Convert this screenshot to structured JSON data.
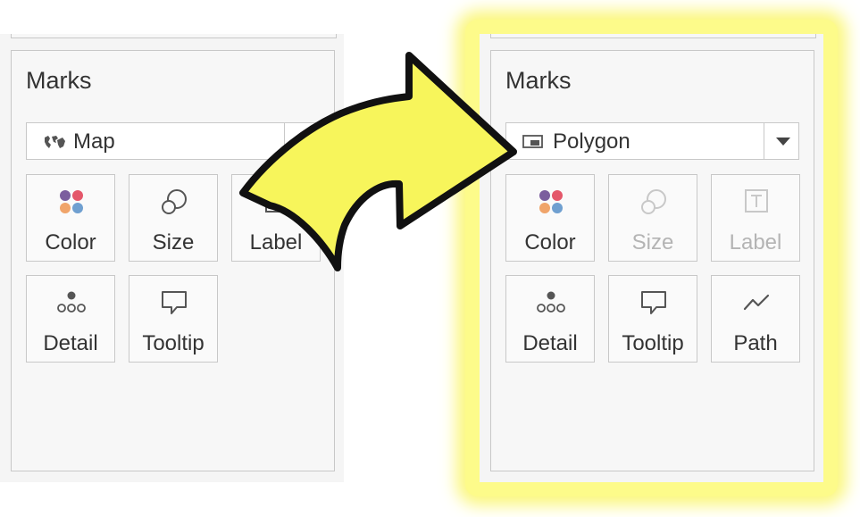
{
  "left_panel": {
    "title": "Marks",
    "mark_type": "Map",
    "buttons": {
      "color": "Color",
      "size": "Size",
      "label": "Label",
      "detail": "Detail",
      "tooltip": "Tooltip"
    }
  },
  "right_panel": {
    "title": "Marks",
    "mark_type": "Polygon",
    "buttons": {
      "color": "Color",
      "size": "Size",
      "label": "Label",
      "detail": "Detail",
      "tooltip": "Tooltip",
      "path": "Path"
    }
  },
  "colors": {
    "highlight": "#fdfb8a",
    "arrow_fill": "#f7f55b",
    "dot_purple": "#7b5e9e",
    "dot_red": "#e4576a",
    "dot_orange": "#f0a46a",
    "dot_blue": "#6f9fd0"
  },
  "icons": {
    "map": "map-icon",
    "polygon": "polygon-icon",
    "color": "color-dots-icon",
    "size": "size-circles-icon",
    "label": "label-text-icon",
    "detail": "detail-dots-icon",
    "tooltip": "speech-bubble-icon",
    "path": "path-line-icon"
  }
}
